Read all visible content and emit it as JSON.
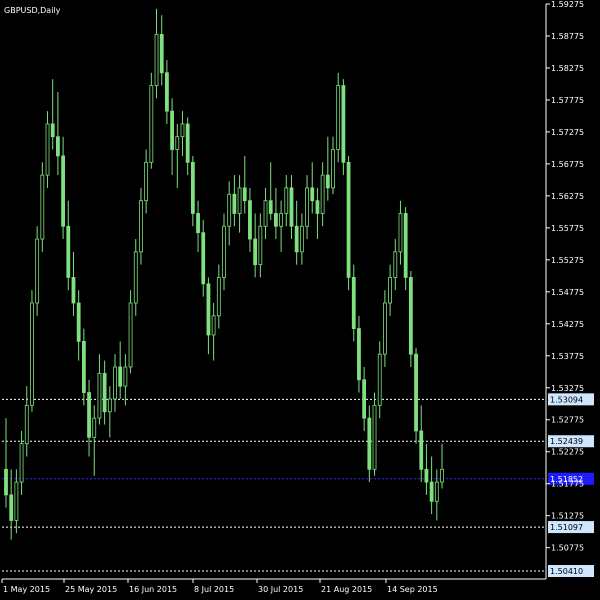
{
  "symbol_label": "GBPUSD,Daily",
  "colors": {
    "background": "#000000",
    "axis": "#ffffff",
    "candle": "#7ee07e",
    "level_line": "#ffffff",
    "current_line": "#2a2aff",
    "label_bg": "#cfe6ff",
    "current_label_bg": "#1c1cff"
  },
  "chart_data": {
    "type": "candlestick",
    "title": "GBPUSD,Daily",
    "ylim": [
      1.50285,
      1.59275
    ],
    "y_ticks": [
      "1.59275",
      "1.58775",
      "1.58275",
      "1.57775",
      "1.57275",
      "1.56775",
      "1.56275",
      "1.55775",
      "1.55275",
      "1.54775",
      "1.54275",
      "1.53775",
      "1.53275",
      "1.52775",
      "1.52275",
      "1.51775",
      "1.51275",
      "1.50775"
    ],
    "x_tick_labels": [
      "1 May 2015",
      "25 May 2015",
      "16 Jun 2015",
      "8 Jul 2015",
      "30 Jul 2015",
      "21 Aug 2015",
      "14 Sep 2015"
    ],
    "levels": [
      {
        "value": 1.53094,
        "label": "1.53094",
        "style": "dashed",
        "kind": "level"
      },
      {
        "value": 1.52439,
        "label": "1.52439",
        "style": "dashed",
        "kind": "level"
      },
      {
        "value": 1.51852,
        "label": "1.51852",
        "style": "dashed",
        "kind": "current"
      },
      {
        "value": 1.51097,
        "label": "1.51097",
        "style": "dashed",
        "kind": "level"
      },
      {
        "value": 1.5041,
        "label": "1.50410",
        "style": "dashed",
        "kind": "level"
      }
    ],
    "candles": [
      [
        1.52,
        1.528,
        1.514,
        1.516
      ],
      [
        1.516,
        1.52,
        1.509,
        1.512
      ],
      [
        1.512,
        1.52,
        1.51,
        1.518
      ],
      [
        1.518,
        1.526,
        1.516,
        1.524
      ],
      [
        1.524,
        1.533,
        1.522,
        1.53
      ],
      [
        1.53,
        1.548,
        1.529,
        1.546
      ],
      [
        1.546,
        1.558,
        1.544,
        1.556
      ],
      [
        1.556,
        1.568,
        1.554,
        1.566
      ],
      [
        1.566,
        1.576,
        1.564,
        1.574
      ],
      [
        1.574,
        1.581,
        1.57,
        1.572
      ],
      [
        1.572,
        1.579,
        1.566,
        1.569
      ],
      [
        1.569,
        1.572,
        1.556,
        1.558
      ],
      [
        1.558,
        1.562,
        1.548,
        1.55
      ],
      [
        1.55,
        1.554,
        1.544,
        1.546
      ],
      [
        1.546,
        1.548,
        1.537,
        1.54
      ],
      [
        1.54,
        1.542,
        1.53,
        1.532
      ],
      [
        1.532,
        1.534,
        1.522,
        1.525
      ],
      [
        1.525,
        1.53,
        1.519,
        1.528
      ],
      [
        1.528,
        1.538,
        1.527,
        1.535
      ],
      [
        1.535,
        1.537,
        1.527,
        1.529
      ],
      [
        1.529,
        1.533,
        1.525,
        1.531
      ],
      [
        1.531,
        1.538,
        1.529,
        1.536
      ],
      [
        1.536,
        1.54,
        1.531,
        1.533
      ],
      [
        1.533,
        1.538,
        1.53,
        1.536
      ],
      [
        1.536,
        1.548,
        1.535,
        1.546
      ],
      [
        1.546,
        1.556,
        1.544,
        1.554
      ],
      [
        1.554,
        1.564,
        1.552,
        1.562
      ],
      [
        1.562,
        1.57,
        1.56,
        1.568
      ],
      [
        1.568,
        1.582,
        1.567,
        1.58
      ],
      [
        1.58,
        1.592,
        1.578,
        1.588
      ],
      [
        1.588,
        1.591,
        1.58,
        1.582
      ],
      [
        1.582,
        1.584,
        1.574,
        1.576
      ],
      [
        1.576,
        1.578,
        1.566,
        1.57
      ],
      [
        1.57,
        1.574,
        1.564,
        1.572
      ],
      [
        1.572,
        1.576,
        1.569,
        1.574
      ],
      [
        1.574,
        1.575,
        1.566,
        1.568
      ],
      [
        1.568,
        1.569,
        1.558,
        1.56
      ],
      [
        1.56,
        1.562,
        1.554,
        1.557
      ],
      [
        1.557,
        1.559,
        1.547,
        1.549
      ],
      [
        1.549,
        1.55,
        1.538,
        1.541
      ],
      [
        1.541,
        1.546,
        1.537,
        1.544
      ],
      [
        1.544,
        1.552,
        1.542,
        1.55
      ],
      [
        1.55,
        1.56,
        1.548,
        1.558
      ],
      [
        1.558,
        1.565,
        1.555,
        1.563
      ],
      [
        1.563,
        1.566,
        1.558,
        1.56
      ],
      [
        1.56,
        1.566,
        1.557,
        1.564
      ],
      [
        1.564,
        1.569,
        1.56,
        1.562
      ],
      [
        1.562,
        1.564,
        1.554,
        1.556
      ],
      [
        1.556,
        1.56,
        1.55,
        1.552
      ],
      [
        1.552,
        1.56,
        1.55,
        1.558
      ],
      [
        1.558,
        1.564,
        1.556,
        1.562
      ],
      [
        1.562,
        1.568,
        1.559,
        1.56
      ],
      [
        1.56,
        1.564,
        1.556,
        1.558
      ],
      [
        1.558,
        1.562,
        1.554,
        1.56
      ],
      [
        1.56,
        1.566,
        1.558,
        1.564
      ],
      [
        1.564,
        1.566,
        1.556,
        1.558
      ],
      [
        1.558,
        1.562,
        1.552,
        1.554
      ],
      [
        1.554,
        1.56,
        1.552,
        1.558
      ],
      [
        1.558,
        1.566,
        1.556,
        1.564
      ],
      [
        1.564,
        1.568,
        1.56,
        1.562
      ],
      [
        1.562,
        1.564,
        1.556,
        1.56
      ],
      [
        1.56,
        1.568,
        1.558,
        1.566
      ],
      [
        1.566,
        1.572,
        1.562,
        1.564
      ],
      [
        1.564,
        1.572,
        1.563,
        1.57
      ],
      [
        1.57,
        1.582,
        1.568,
        1.58
      ],
      [
        1.58,
        1.581,
        1.566,
        1.568
      ],
      [
        1.568,
        1.569,
        1.548,
        1.55
      ],
      [
        1.55,
        1.552,
        1.54,
        1.542
      ],
      [
        1.542,
        1.544,
        1.532,
        1.534
      ],
      [
        1.534,
        1.536,
        1.526,
        1.528
      ],
      [
        1.528,
        1.53,
        1.518,
        1.52
      ],
      [
        1.52,
        1.532,
        1.519,
        1.53
      ],
      [
        1.53,
        1.54,
        1.528,
        1.538
      ],
      [
        1.538,
        1.548,
        1.536,
        1.546
      ],
      [
        1.546,
        1.552,
        1.544,
        1.55
      ],
      [
        1.55,
        1.556,
        1.548,
        1.554
      ],
      [
        1.554,
        1.562,
        1.552,
        1.56
      ],
      [
        1.56,
        1.561,
        1.548,
        1.55
      ],
      [
        1.55,
        1.551,
        1.536,
        1.538
      ],
      [
        1.538,
        1.539,
        1.524,
        1.526
      ],
      [
        1.526,
        1.53,
        1.518,
        1.52
      ],
      [
        1.52,
        1.524,
        1.516,
        1.518
      ],
      [
        1.518,
        1.522,
        1.513,
        1.515
      ],
      [
        1.515,
        1.52,
        1.512,
        1.518
      ],
      [
        1.518,
        1.524,
        1.517,
        1.52
      ]
    ]
  }
}
